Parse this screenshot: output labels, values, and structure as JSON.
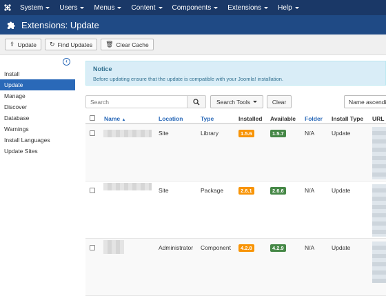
{
  "navbar": {
    "logo": "joomla-logo",
    "menus": [
      {
        "label": "System"
      },
      {
        "label": "Users"
      },
      {
        "label": "Menus"
      },
      {
        "label": "Content"
      },
      {
        "label": "Components"
      },
      {
        "label": "Extensions"
      },
      {
        "label": "Help"
      }
    ]
  },
  "header": {
    "title": "Extensions: Update",
    "icon": "puzzle-icon"
  },
  "toolbar": {
    "update": "Update",
    "find_updates": "Find Updates",
    "clear_cache": "Clear Cache"
  },
  "sidebar": {
    "items": [
      {
        "label": "Install"
      },
      {
        "label": "Update",
        "active": true
      },
      {
        "label": "Manage"
      },
      {
        "label": "Discover"
      },
      {
        "label": "Database"
      },
      {
        "label": "Warnings"
      },
      {
        "label": "Install Languages"
      },
      {
        "label": "Update Sites"
      }
    ]
  },
  "notice": {
    "title": "Notice",
    "body": "Before updating ensure that the update is compatible with your Joomla! installation."
  },
  "filters": {
    "search_placeholder": "Search",
    "search_tools": "Search Tools",
    "clear": "Clear",
    "sort": "Name ascending"
  },
  "table": {
    "headers": {
      "name": "Name",
      "location": "Location",
      "type": "Type",
      "installed": "Installed",
      "available": "Available",
      "folder": "Folder",
      "install_type": "Install Type",
      "url": "URL"
    },
    "rows": [
      {
        "location": "Site",
        "type": "Library",
        "installed": "1.5.6",
        "available": "1.5.7",
        "folder": "N/A",
        "install_type": "Update"
      },
      {
        "location": "Site",
        "type": "Package",
        "installed": "2.6.1",
        "available": "2.6.6",
        "folder": "N/A",
        "install_type": "Update"
      },
      {
        "location": "Administrator",
        "type": "Component",
        "installed": "4.2.8",
        "available": "4.2.9",
        "folder": "N/A",
        "install_type": "Update"
      }
    ]
  },
  "colors": {
    "navbar": "#1a3867",
    "header": "#1f4a85",
    "accent": "#2a69b8",
    "installed_badge": "#f89406",
    "available_badge": "#468847"
  }
}
